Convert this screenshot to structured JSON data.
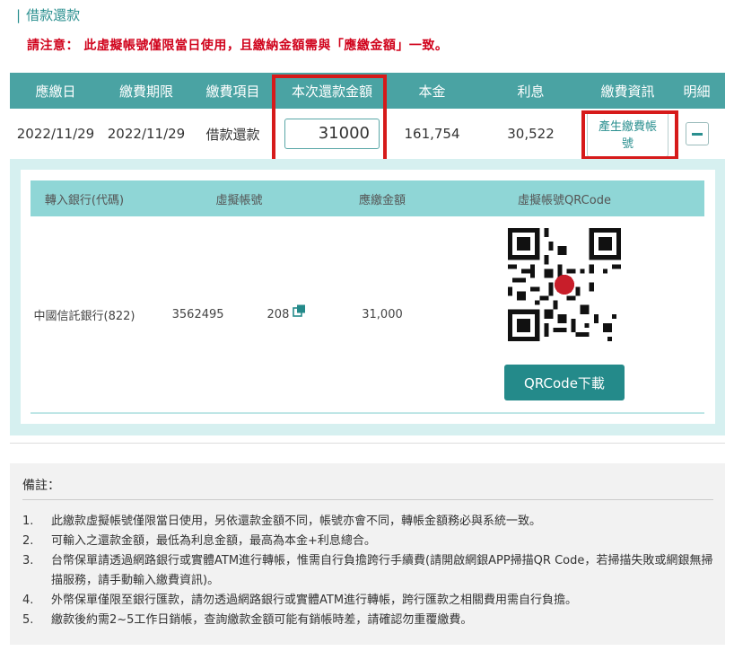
{
  "section_title": "借款還款",
  "notice": "請注意： 此虛擬帳號僅限當日使用，且繳納金額需與「應繳金額」一致。",
  "table": {
    "headers": [
      "應繳日",
      "繳費期限",
      "繳費項目",
      "本次還款金額",
      "本金",
      "利息",
      "繳費資訊",
      "明細"
    ],
    "row": {
      "due_date": "2022/11/29",
      "deadline": "2022/11/29",
      "item": "借款還款",
      "repay_amount": "31000",
      "principal": "161,754",
      "interest": "30,522",
      "generate_button": "產生繳費帳號"
    }
  },
  "detail": {
    "headers": [
      "轉入銀行(代碼)",
      "虛擬帳號",
      "應繳金額",
      "虛擬帳號QRCode"
    ],
    "bank": "中國信託銀行(822)",
    "account_prefix": "3562495",
    "account_suffix": "208",
    "amount": "31,000",
    "qr_download": "QRCode下載"
  },
  "notes": {
    "title": "備註：",
    "items": [
      {
        "num": "1.",
        "text": "此繳款虛擬帳號僅限當日使用，另依還款金額不同，帳號亦會不同，轉帳金額務必與系統一致。"
      },
      {
        "num": "2.",
        "text": "可輸入之還款金額，最低為利息金額，最高為本金+利息總合。"
      },
      {
        "num": "3.",
        "text": "台幣保單請透過網路銀行或實體ATM進行轉帳，惟需自行負擔跨行手續費(請開啟網銀APP掃描QR Code，若掃描失敗或網銀無掃描服務，請手動輸入繳費資訊)。"
      },
      {
        "num": "4.",
        "text": "外幣保單僅限至銀行匯款，請勿透過網路銀行或實體ATM進行轉帳，跨行匯款之相關費用需自行負擔。"
      },
      {
        "num": "5.",
        "text": "繳款後約需2~5工作日銷帳，查詢繳款金額可能有銷帳時差，請確認勿重覆繳費。"
      }
    ]
  },
  "colors": {
    "header_teal": "#4aa3a3",
    "notice_red": "#d0021b",
    "highlight_red": "#d61a1a",
    "button_teal": "#248a8a"
  }
}
